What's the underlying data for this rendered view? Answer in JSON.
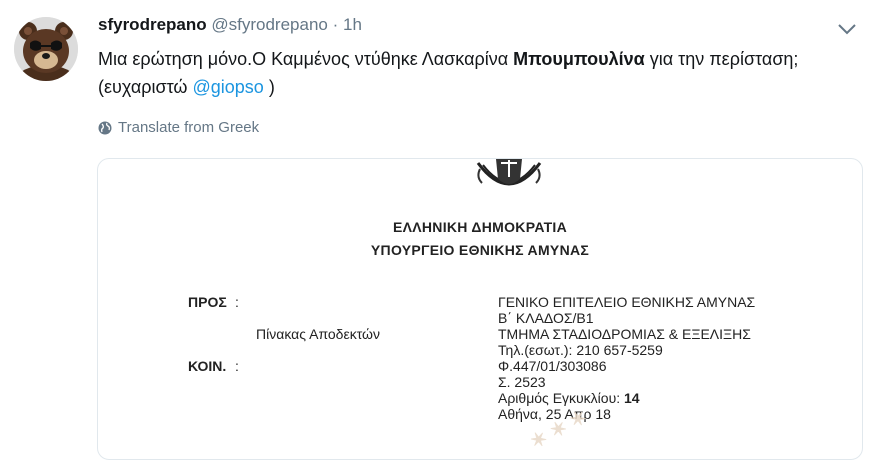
{
  "tweet": {
    "name": "sfyrodrepano",
    "handle": "@sfyrodrepano",
    "separator": "·",
    "time": "1h",
    "text_part1": "Μια ερώτηση μόνο.Ο Καμμένος ντύθηκε Λασκαρίνα ",
    "text_bold": "Μπουμπουλίνα",
    "text_part2": " για την περίσταση; (ευχαριστώ ",
    "mention": "@giopso",
    "text_part3": " )",
    "translate_label": "Translate from Greek"
  },
  "document": {
    "line1": "ΕΛΛΗΝΙΚΗ ΔΗΜΟΚΡΑΤΙΑ",
    "line2": "ΥΠΟΥΡΓΕΙΟ ΕΘΝΙΚΗΣ ΑΜΥΝΑΣ",
    "pros_label": "ΠΡΟΣ",
    "pros_colon": ":",
    "recipients_label": "Πίνακας Αποδεκτών",
    "koin_label": "ΚΟΙΝ.",
    "koin_colon": ":",
    "right_lines": [
      "ΓΕΝΙΚΟ ΕΠΙΤΕΛΕΙΟ ΕΘΝΙΚΗΣ ΑΜΥΝΑΣ",
      "Β΄ ΚΛΑΔΟΣ/Β1",
      "ΤΜΗΜΑ ΣΤΑΔΙΟΔΡΟΜΙΑΣ & ΕΞΕΛΙΞΗΣ",
      "Τηλ.(εσωτ.): 210 657-5259",
      "Φ.447/01/303086",
      "Σ. 2523"
    ],
    "circular_label": "Αριθμός Εγκυκλίου: ",
    "circular_number": "14",
    "date": "Αθήνα, 25 Απρ 18"
  }
}
